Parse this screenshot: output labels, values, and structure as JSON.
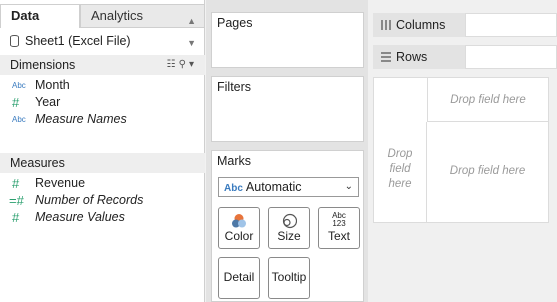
{
  "tabs": {
    "data": "Data",
    "analytics": "Analytics"
  },
  "source": {
    "name": "Sheet1 (Excel File)"
  },
  "dimensions": {
    "title": "Dimensions",
    "items": [
      {
        "icon": "Abc",
        "label": "Month"
      },
      {
        "icon": "#",
        "label": "Year"
      },
      {
        "icon": "Abc",
        "label": "Measure Names"
      }
    ]
  },
  "measures": {
    "title": "Measures",
    "items": [
      {
        "icon": "#",
        "label": "Revenue"
      },
      {
        "icon": "=#",
        "label": "Number of Records"
      },
      {
        "icon": "#",
        "label": "Measure Values"
      }
    ]
  },
  "shelves": {
    "pages": "Pages",
    "filters": "Filters",
    "columns": "Columns",
    "rows": "Rows"
  },
  "marks": {
    "title": "Marks",
    "type_prefix": "Abc",
    "type": "Automatic",
    "buttons": {
      "color": "Color",
      "size": "Size",
      "text": "Text",
      "detail": "Detail",
      "tooltip": "Tooltip"
    },
    "text_icon_top": "Abc",
    "text_icon_bottom": "123"
  },
  "canvas": {
    "drop_top": "Drop field here",
    "drop_left": "Drop field here",
    "drop_center": "Drop field here"
  },
  "colors": {
    "dimension": "#3a7bbf",
    "measure": "#2a9f6e",
    "color_orange": "#e8743b",
    "color_blue": "#4e79a7"
  }
}
